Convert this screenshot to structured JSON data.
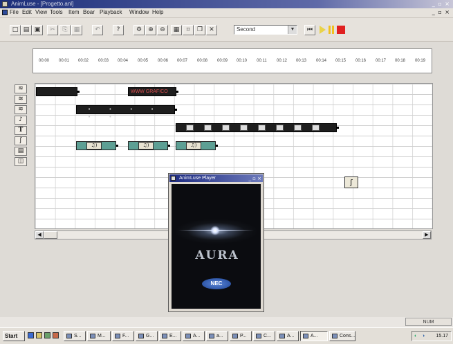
{
  "window": {
    "title": "AnimLuse - [Progetto.anl]",
    "controls": "_ ▫ ×"
  },
  "menu": {
    "items": [
      "File",
      "Edit",
      "View",
      "Tools",
      "Item",
      "Boar",
      "Playback",
      "Window",
      "Help"
    ],
    "mdi_controls": "_ ▫ ×"
  },
  "toolbar": {
    "buttons": [
      "new",
      "open",
      "save",
      "cut",
      "copy",
      "paste",
      "undo",
      "help",
      "properties",
      "zoom-in",
      "zoom-out",
      "grid",
      "snap",
      "duplicate",
      "delete"
    ],
    "time_unit": "Second",
    "playback": [
      "play",
      "pause",
      "stop"
    ],
    "colors": {
      "play": "#e9d34a",
      "pause": "#f0c020",
      "stop": "#e02020"
    }
  },
  "ruler": {
    "ticks": [
      "00:00",
      "00:01",
      "00:02",
      "00:03",
      "00:04",
      "00:05",
      "00:06",
      "00:07",
      "00:08",
      "00:09",
      "00:10",
      "00:11",
      "00:12",
      "00:13",
      "00:14",
      "00:15",
      "00:16",
      "00:17",
      "00:18",
      "00:19"
    ]
  },
  "tracks": [
    {
      "type": "video",
      "icon": "film-icon"
    },
    {
      "type": "video",
      "icon": "film-icon"
    },
    {
      "type": "video",
      "icon": "film-icon"
    },
    {
      "type": "audio",
      "icon": "speaker-icon"
    },
    {
      "type": "text",
      "icon": "text-T-icon"
    },
    {
      "type": "effect",
      "icon": "effect-icon"
    },
    {
      "type": "document",
      "icon": "page-icon"
    },
    {
      "type": "object",
      "icon": "cube-icon"
    }
  ],
  "clips": {
    "track1": [
      {
        "label": ""
      },
      {
        "label": "WWW GRAFICO"
      }
    ],
    "audio_label": "♫)",
    "clip_colors": {
      "dark": "#1e1e1e",
      "audio": "#5d9f94"
    }
  },
  "player": {
    "title": "AnimLuse Player",
    "controls": "_ ▫ ×",
    "brand_text": "AURA",
    "logo_text": "NEC"
  },
  "status": {
    "panel": "NUM"
  },
  "taskbar": {
    "start": "Start",
    "tasks": [
      "S...",
      "M...",
      "F...",
      "G...",
      "E...",
      "A...",
      "a...",
      "P...",
      "C...",
      "A...",
      "A...",
      "Cons..."
    ],
    "clock": "15.17"
  }
}
